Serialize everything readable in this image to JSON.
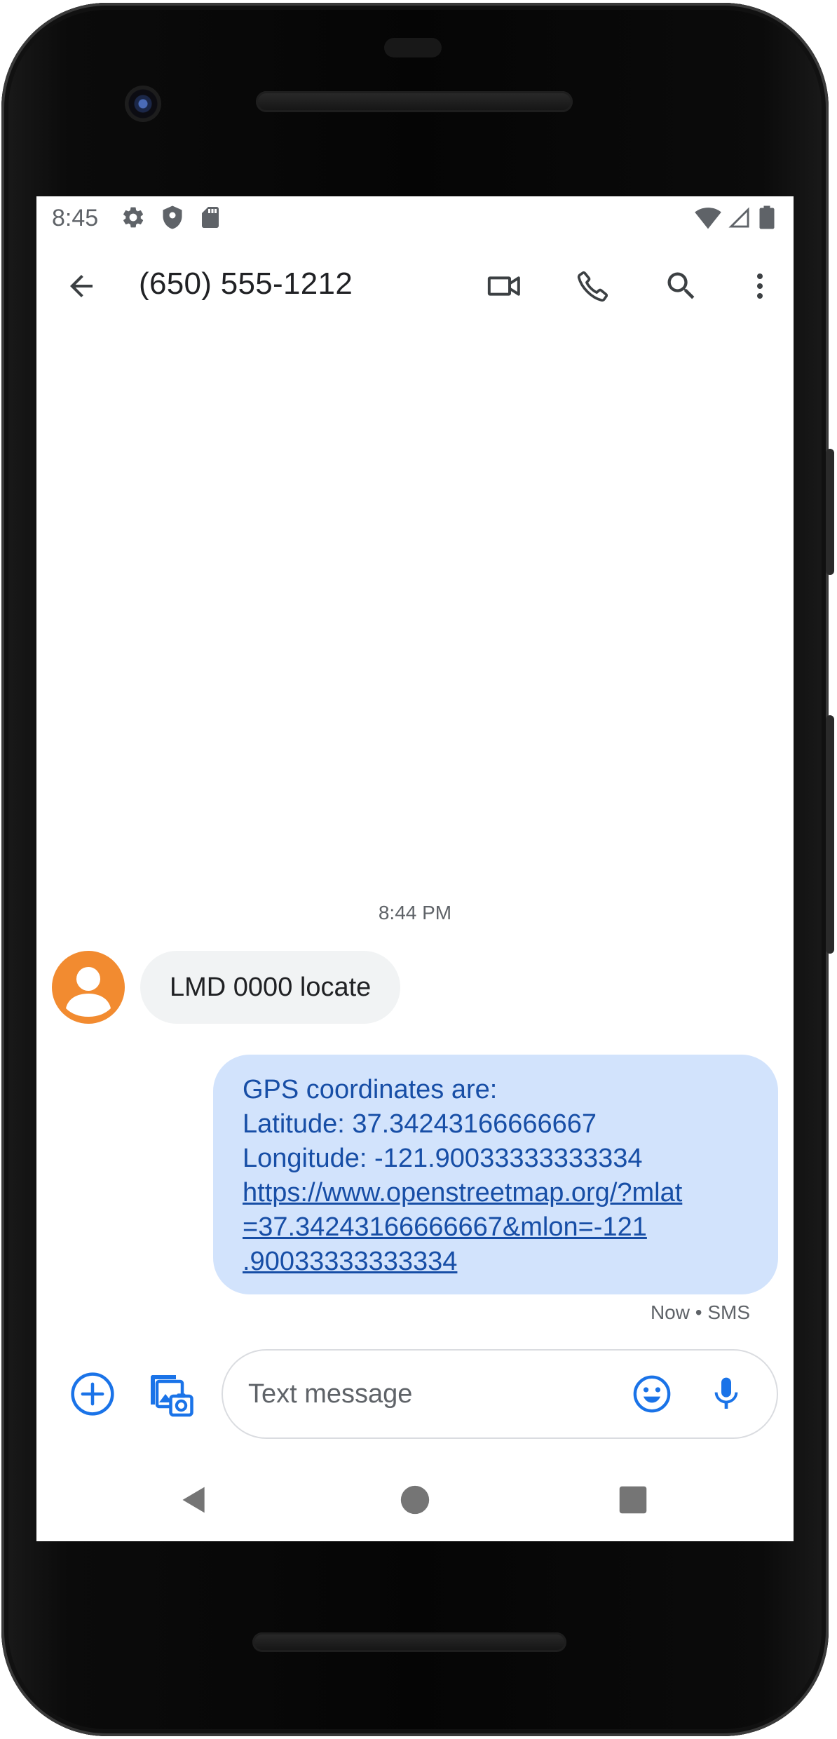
{
  "status_bar": {
    "time": "8:45",
    "left_icons": [
      "gear-icon",
      "shield-icon",
      "sd-card-icon"
    ],
    "right_icons": [
      "wifi-icon",
      "cell-signal-icon",
      "battery-icon"
    ]
  },
  "app_bar": {
    "title": "(650) 555-1212",
    "actions": [
      "back-arrow-icon",
      "video-call-icon",
      "phone-icon",
      "search-icon",
      "more-vert-icon"
    ]
  },
  "conversation": {
    "timestamp": "8:44 PM",
    "incoming": {
      "text": "LMD 0000 locate"
    },
    "outgoing": {
      "line1": "GPS coordinates are:",
      "line2": "Latitude: 37.34243166666667",
      "line3": "Longitude: -121.90033333333334",
      "link_line1": "https://www.openstreetmap.org/?mlat",
      "link_line2": "=37.34243166666667&mlon=-121",
      "link_line3": ".90033333333334",
      "meta": "Now • SMS"
    }
  },
  "compose": {
    "placeholder": "Text message",
    "value": ""
  },
  "colors": {
    "accent": "#1a73e8",
    "outgoing_bubble": "#d2e3fc",
    "outgoing_text": "#174ea6",
    "incoming_bubble": "#f1f3f4",
    "avatar": "#f28b30"
  }
}
